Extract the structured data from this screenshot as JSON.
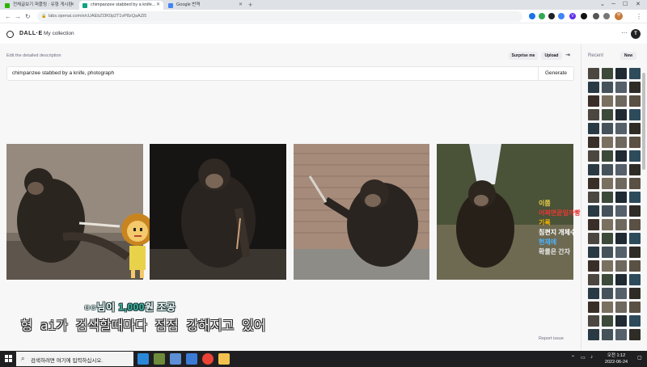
{
  "browser": {
    "tabs": [
      {
        "title": "전체글보기 퍼플링 : 유형 게시판"
      },
      {
        "title": "chimpanzee stabbed by a knife..."
      },
      {
        "title": "Google 번역"
      }
    ],
    "url": "labs.openai.com/e/cUAEbZI3K0p2T1vP8zQaAZi5",
    "profile_initial": "부"
  },
  "app": {
    "brand": "DALL·E",
    "nav_collection": "My collection",
    "more_label": "···",
    "user_initial": "T"
  },
  "editor": {
    "description_label": "Edit the detailed description",
    "surprise_label": "Surprise me",
    "upload_label": "Upload",
    "prompt_value": "chimpanzee stabbed by a knife, photograph",
    "generate_label": "Generate",
    "report_label": "Report issue"
  },
  "image4_caption": [
    "이쯤",
    "어쩌면끝일까빵",
    "기록",
    "침편지 개체수",
    "현재에",
    "확률은 간자"
  ],
  "sidebar": {
    "recent_label": "Recent",
    "new_label": "New"
  },
  "overlay": {
    "donation_prefix": "○○님이 ",
    "donation_amount": "1,000",
    "donation_suffix": "원 조공",
    "subtitle": "형 ai가 검색할때마다 점점 강해지고 있어"
  },
  "taskbar": {
    "search_placeholder": "검색하려면 여기에 입력하십시오.",
    "time": "오전 1:12",
    "date": "2022-06-24"
  }
}
